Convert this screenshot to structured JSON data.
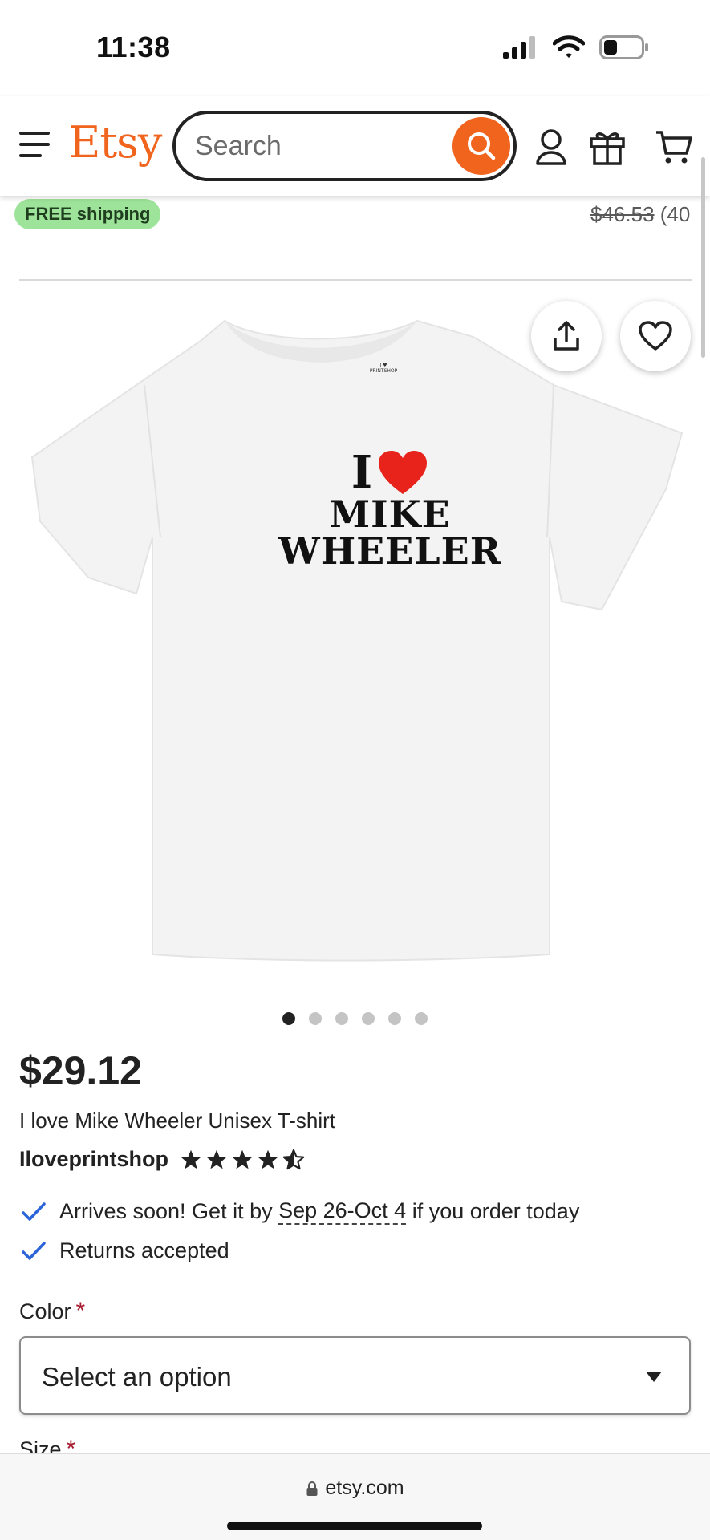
{
  "status_bar": {
    "time": "11:38"
  },
  "header": {
    "logo": "Etsy",
    "search": {
      "placeholder": "Search",
      "value": ""
    }
  },
  "strip": {
    "free_shipping": "FREE shipping",
    "original_price": "$46.53",
    "discount_partial": " (40"
  },
  "product": {
    "image_text": {
      "line1": "I",
      "line2": "MIKE",
      "line3": "WHEELER",
      "tag": "I ♥ PRINTSHOP"
    },
    "carousel": {
      "count": 6,
      "active": 0
    },
    "price": "$29.12",
    "title": "I love Mike Wheeler Unisex T-shirt",
    "shop_name": "Iloveprintshop",
    "rating": 4.5,
    "arrives_prefix": "Arrives soon! Get it by ",
    "arrives_dates": "Sep 26-Oct 4",
    "arrives_suffix": " if you order today",
    "returns": "Returns accepted"
  },
  "options": {
    "color_label": "Color",
    "color_select": "Select an option",
    "size_label": "Size",
    "required_mark": "*"
  },
  "browser": {
    "url": "etsy.com"
  },
  "colors": {
    "brand": "#f1641e",
    "badge": "#9ee39a",
    "check": "#2b63d9",
    "required": "#a61a2e"
  }
}
